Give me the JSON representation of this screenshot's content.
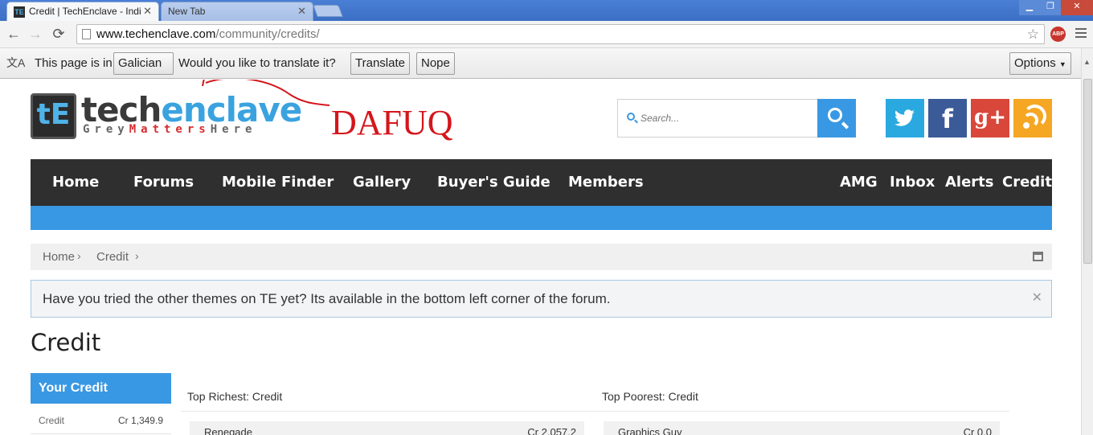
{
  "browser": {
    "tabs": [
      {
        "label": "Credit | TechEnclave - Indi",
        "favicon": "TE"
      },
      {
        "label": "New Tab"
      }
    ],
    "url_host": "www.techenclave.com",
    "url_path": "/community/credits/",
    "abp_label": "ABP"
  },
  "translate_bar": {
    "prefix": "This page is in",
    "language": "Galician",
    "question": "Would you like to translate it?",
    "translate_label": "Translate",
    "nope_label": "Nope",
    "options_label": "Options"
  },
  "site": {
    "logo_mark": "tE",
    "brand_part1": "tech",
    "brand_part2": "enclave",
    "tagline_part1": "Grey",
    "tagline_part2": "Matters",
    "tagline_part3": "Here",
    "annotation": "DAFUQ",
    "search_placeholder": "Search...",
    "social": {
      "facebook": "f",
      "googleplus": "g+"
    }
  },
  "nav": {
    "left": [
      "Home",
      "Forums",
      "Mobile Finder",
      "Gallery",
      "Buyer's Guide",
      "Members"
    ],
    "right": [
      "AMG",
      "Inbox",
      "Alerts",
      "Credit"
    ]
  },
  "breadcrumb": [
    "Home",
    "Credit"
  ],
  "notice": "Have you tried the other themes on TE yet? Its available in the bottom left corner of the forum.",
  "page_title": "Credit",
  "your_credit": {
    "heading": "Your Credit",
    "label": "Credit",
    "value": "Cr 1,349.9"
  },
  "top_richest": {
    "title": "Top Richest: Credit",
    "first_name": "Renegade",
    "first_value": "Cr 2,057.2"
  },
  "top_poorest": {
    "title": "Top Poorest: Credit",
    "first_name": "Graphics Guy",
    "first_value": "Cr 0.0"
  },
  "colors": {
    "accent": "#3998e3",
    "nav_bg": "#2f2f2f",
    "annotation": "#d4161c"
  }
}
